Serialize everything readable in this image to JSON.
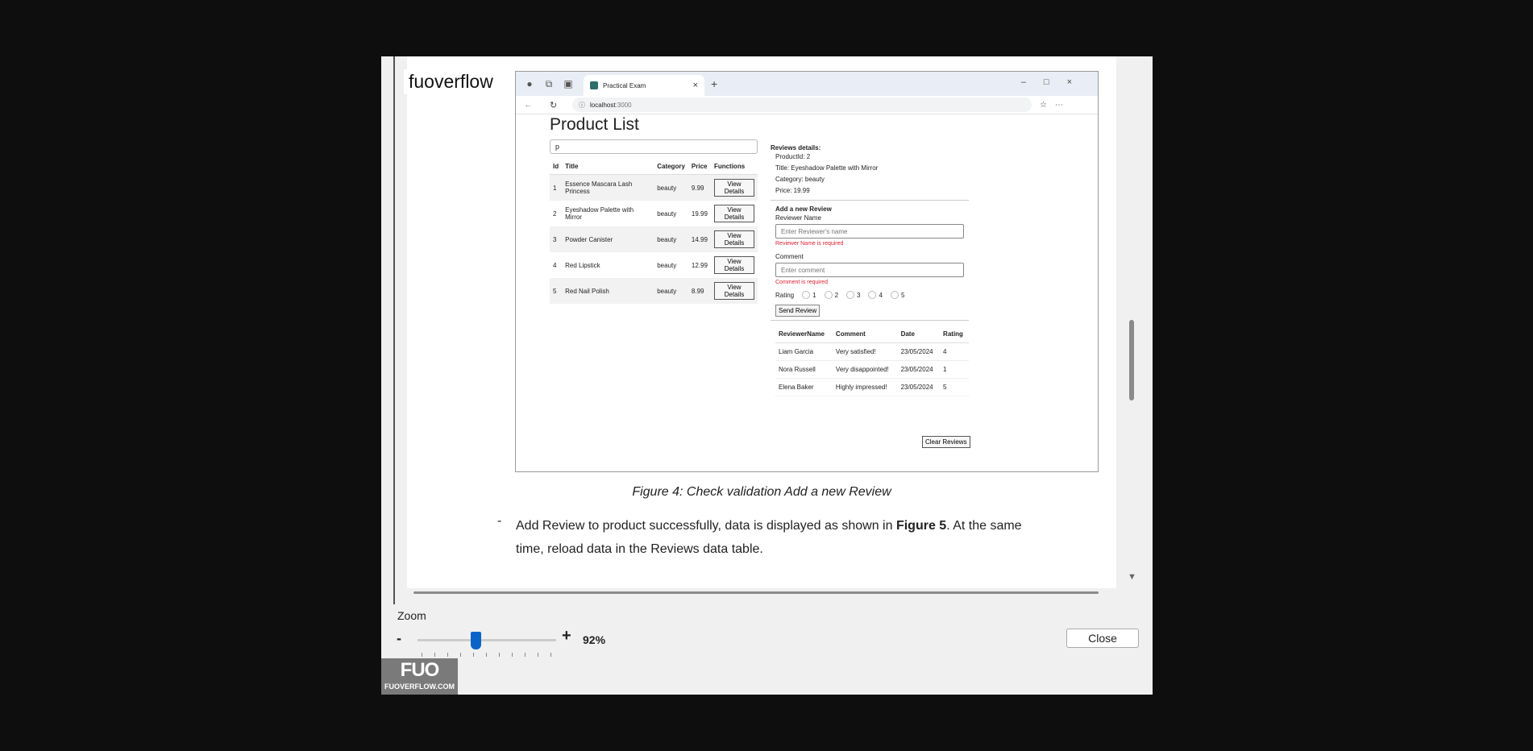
{
  "watermark": "fuoverflow",
  "browser": {
    "tab_title": "Practical Exam",
    "url_host": "localhost",
    "url_port": ":3000"
  },
  "app": {
    "title": "Product List",
    "search_value": "p",
    "product_headers": [
      "Id",
      "Title",
      "Category",
      "Price",
      "Functions"
    ],
    "products": [
      {
        "id": "1",
        "title": "Essence Mascara Lash Princess",
        "category": "beauty",
        "price": "9.99",
        "action": "View Details"
      },
      {
        "id": "2",
        "title": "Eyeshadow Palette with Mirror",
        "category": "beauty",
        "price": "19.99",
        "action": "View Details"
      },
      {
        "id": "3",
        "title": "Powder Canister",
        "category": "beauty",
        "price": "14.99",
        "action": "View Details"
      },
      {
        "id": "4",
        "title": "Red Lipstick",
        "category": "beauty",
        "price": "12.99",
        "action": "View Details"
      },
      {
        "id": "5",
        "title": "Red Nail Polish",
        "category": "beauty",
        "price": "8.99",
        "action": "View Details"
      }
    ],
    "reviews": {
      "heading": "Reviews details:",
      "product_id": "ProductId: 2",
      "product_title": "Title: Eyeshadow Palette with Mirror",
      "product_category": "Category: beauty",
      "product_price": "Price: 19.99",
      "form_heading": "Add a new Review",
      "name_label": "Reviewer Name",
      "name_placeholder": "Enter Reviewer's name",
      "name_error": "Reviewer Name is required",
      "comment_label": "Comment",
      "comment_placeholder": "Enter comment",
      "comment_error": "Comment is required",
      "rating_label": "Rating",
      "rating_options": [
        "1",
        "2",
        "3",
        "4",
        "5"
      ],
      "send_label": "Send Review",
      "table_headers": [
        "ReviewerName",
        "Comment",
        "Date",
        "Rating"
      ],
      "rows": [
        {
          "name": "Liam Garcia",
          "comment": "Very satisfied!",
          "date": "23/05/2024",
          "rating": "4"
        },
        {
          "name": "Nora Russell",
          "comment": "Very disappointed!",
          "date": "23/05/2024",
          "rating": "1"
        },
        {
          "name": "Elena Baker",
          "comment": "Highly impressed!",
          "date": "23/05/2024",
          "rating": "5"
        }
      ],
      "clear_label": "Clear Reviews"
    }
  },
  "doc": {
    "caption": "Figure 4: Check validation Add a new Review",
    "bullet": "-",
    "para_before": "Add Review to product successfully, data is displayed as shown in ",
    "para_bold": "Figure 5",
    "para_after": ". At the same time, reload data in the Reviews data table."
  },
  "viewer": {
    "zoom_label": "Zoom",
    "zoom_minus": "-",
    "zoom_plus": "+",
    "zoom_value": "92%",
    "close_label": "Close",
    "logo_big": "FUO",
    "logo_small": "FUOVERFLOW.COM",
    "accent": "#0a64c8"
  }
}
